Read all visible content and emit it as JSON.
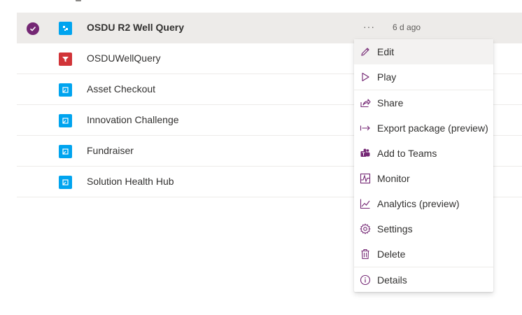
{
  "colors": {
    "accent": "#742774",
    "app_blue": "#00a4ef",
    "app_red": "#d13438",
    "row_selected": "#edebe9"
  },
  "apps": [
    {
      "name": "OSDU R2 Well Query",
      "icon": "model-driven-app-icon",
      "color": "blue",
      "selected": true,
      "more": "···",
      "modified": "6 d ago"
    },
    {
      "name": "OSDUWellQuery",
      "icon": "funnel-app-icon",
      "color": "red"
    },
    {
      "name": "Asset Checkout",
      "icon": "canvas-app-icon",
      "color": "blue"
    },
    {
      "name": "Innovation Challenge",
      "icon": "canvas-app-icon",
      "color": "blue"
    },
    {
      "name": "Fundraiser",
      "icon": "canvas-app-icon",
      "color": "blue"
    },
    {
      "name": "Solution Health Hub",
      "icon": "canvas-app-icon",
      "color": "blue"
    }
  ],
  "context_menu": {
    "items": [
      {
        "label": "Edit",
        "icon": "pencil-icon"
      },
      {
        "label": "Play",
        "icon": "play-icon"
      },
      {
        "label": "Share",
        "icon": "share-icon"
      },
      {
        "label": "Export package (preview)",
        "icon": "export-arrow-icon"
      },
      {
        "label": "Add to Teams",
        "icon": "teams-icon"
      },
      {
        "label": "Monitor",
        "icon": "monitor-icon"
      },
      {
        "label": "Analytics (preview)",
        "icon": "analytics-icon"
      },
      {
        "label": "Settings",
        "icon": "gear-icon"
      },
      {
        "label": "Delete",
        "icon": "trash-icon"
      },
      {
        "label": "Details",
        "icon": "info-icon"
      }
    ]
  }
}
